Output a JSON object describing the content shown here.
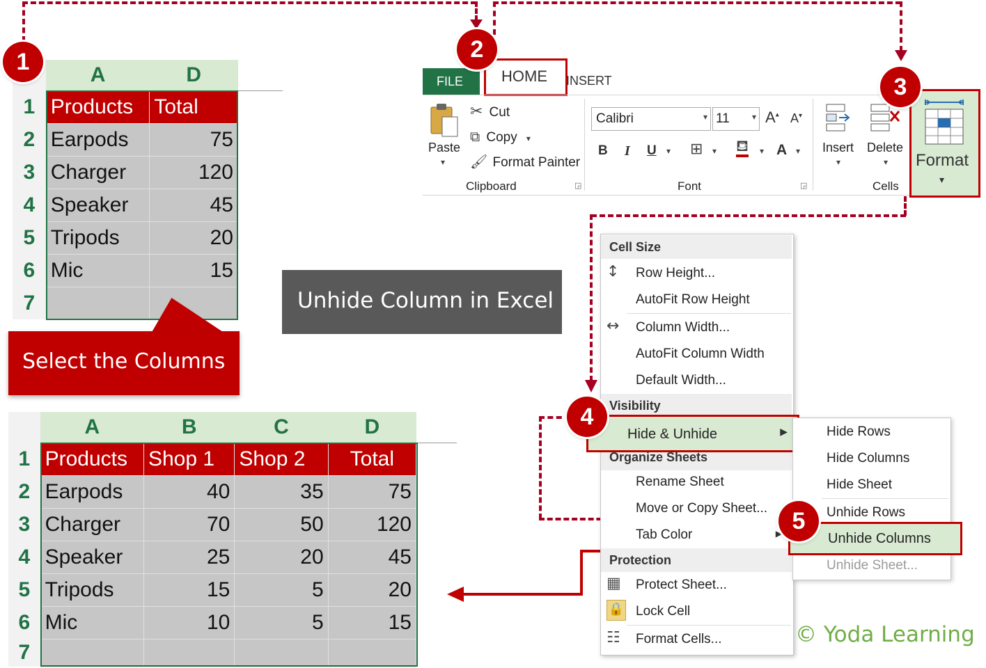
{
  "callouts": {
    "step1": "1",
    "step2": "2",
    "step3": "3",
    "step4": "4",
    "step5": "5"
  },
  "title_banner": "Unhide Column in Excel",
  "select_callout": "Select the Columns",
  "copyright": "© Yoda Learning",
  "sheet_before": {
    "col_headers": [
      "A",
      "D"
    ],
    "row_numbers": [
      "1",
      "2",
      "3",
      "4",
      "5",
      "6",
      "7"
    ],
    "rows": [
      [
        "Products",
        "Total"
      ],
      [
        "Earpods",
        "75"
      ],
      [
        "Charger",
        "120"
      ],
      [
        "Speaker",
        "45"
      ],
      [
        "Tripods",
        "20"
      ],
      [
        "Mic",
        "15"
      ]
    ]
  },
  "sheet_after": {
    "col_headers": [
      "A",
      "B",
      "C",
      "D"
    ],
    "row_numbers": [
      "1",
      "2",
      "3",
      "4",
      "5",
      "6",
      "7"
    ],
    "rows": [
      [
        "Products",
        "Shop 1",
        "Shop 2",
        "Total"
      ],
      [
        "Earpods",
        "40",
        "35",
        "75"
      ],
      [
        "Charger",
        "70",
        "50",
        "120"
      ],
      [
        "Speaker",
        "25",
        "20",
        "45"
      ],
      [
        "Tripods",
        "15",
        "5",
        "20"
      ],
      [
        "Mic",
        "10",
        "5",
        "15"
      ]
    ]
  },
  "ribbon": {
    "tabs": {
      "file": "FILE",
      "home": "HOME",
      "insert": "INSERT"
    },
    "clipboard": {
      "paste": "Paste",
      "cut": "Cut",
      "copy": "Copy",
      "format_painter": "Format Painter",
      "group_label": "Clipboard"
    },
    "font": {
      "name": "Calibri",
      "size": "11",
      "grow": "A",
      "shrink": "A",
      "bold": "B",
      "italic": "I",
      "underline": "U",
      "font_color": "A",
      "group_label": "Font"
    },
    "cells": {
      "insert": "Insert",
      "delete": "Delete",
      "format": "Format",
      "group_label": "Cells"
    }
  },
  "format_menu": {
    "section_cell_size": "Cell Size",
    "row_height": "Row Height...",
    "autofit_row": "AutoFit Row Height",
    "column_width": "Column Width...",
    "autofit_column": "AutoFit Column Width",
    "default_width": "Default Width...",
    "section_visibility": "Visibility",
    "hide_unhide": "Hide & Unhide",
    "section_organize": "Organize Sheets",
    "rename_sheet": "Rename Sheet",
    "move_copy": "Move or Copy Sheet...",
    "tab_color": "Tab Color",
    "section_protection": "Protection",
    "protect_sheet": "Protect Sheet...",
    "lock_cell": "Lock Cell",
    "format_cells": "Format Cells..."
  },
  "submenu": {
    "hide_rows": "Hide Rows",
    "hide_columns": "Hide Columns",
    "hide_sheet": "Hide Sheet",
    "unhide_rows": "Unhide Rows",
    "unhide_columns": "Unhide Columns",
    "unhide_sheet": "Unhide Sheet..."
  },
  "colors": {
    "accent_red": "#c00000",
    "dash_red": "#a50021",
    "excel_green": "#217346",
    "banner_grey": "#595959",
    "copyright_green": "#70ad47"
  }
}
